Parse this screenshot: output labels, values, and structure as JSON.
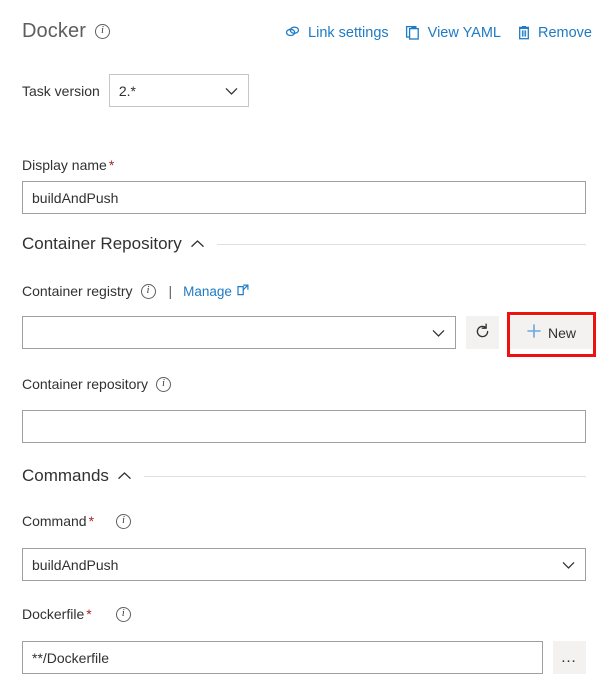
{
  "header": {
    "title": "Docker",
    "info_icon": "info-icon",
    "actions": [
      {
        "label": "Link settings",
        "icon": "link-icon"
      },
      {
        "label": "View YAML",
        "icon": "clipboard-icon"
      },
      {
        "label": "Remove",
        "icon": "trash-icon"
      }
    ]
  },
  "task_version": {
    "label": "Task version",
    "value": "2.*",
    "chevron_icon": "chevron-down-icon"
  },
  "display_name": {
    "label": "Display name",
    "required": "*",
    "value": "buildAndPush"
  },
  "sections": [
    {
      "title": "Container Repository",
      "chevron_icon": "chevron-up-icon"
    },
    {
      "title": "Commands",
      "chevron_icon": "chevron-up-icon"
    }
  ],
  "container_registry": {
    "label": "Container registry",
    "info_icon": "info-icon",
    "separator": "|",
    "manage_label": "Manage",
    "external_link_icon": "external-link-icon",
    "value": "",
    "chevron_icon": "chevron-down-icon",
    "refresh_icon": "refresh-icon",
    "new_label": "New",
    "plus_icon": "plus-icon"
  },
  "container_repository": {
    "label": "Container repository",
    "info_icon": "info-icon",
    "value": ""
  },
  "command": {
    "label": "Command",
    "required": "*",
    "info_icon": "info-icon",
    "value": "buildAndPush",
    "chevron_icon": "chevron-down-icon"
  },
  "dockerfile": {
    "label": "Dockerfile",
    "required": "*",
    "info_icon": "info-icon",
    "value": "**/Dockerfile",
    "browse_label": "…"
  },
  "colors": {
    "accent_blue": "#1e7bc4",
    "required_red": "#a4262c",
    "highlight_red": "#ee1111",
    "title_gray": "#605e5c",
    "button_bg": "#f3f2f1",
    "border_gray": "#a19f9d"
  }
}
